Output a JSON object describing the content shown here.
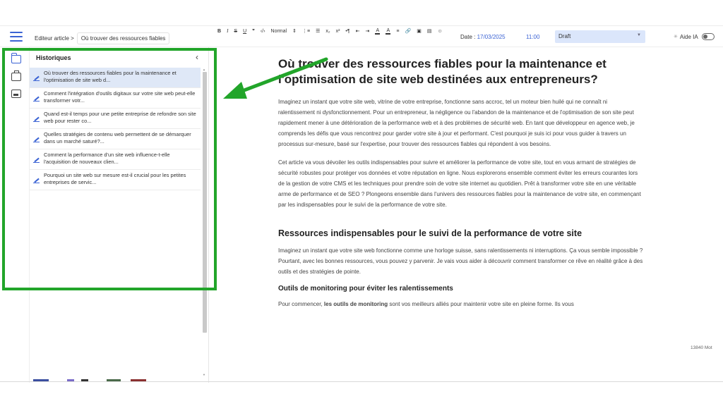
{
  "topbar": {
    "breadcrumb_root": "Editeur article >",
    "breadcrumb_current": "Où trouver des ressources fiables",
    "date_label": "Date :",
    "date_value": "17/03/2025",
    "time_value": "11:00",
    "status": "Draft",
    "ai_label": "Aide IA"
  },
  "history": {
    "title": "Historiques",
    "items": [
      {
        "text": "Où trouver des ressources fiables pour la maintenance et l'optimisation de site web d..."
      },
      {
        "text": "Comment l'intégration d'outils digitaux sur votre site web peut-elle transformer votr..."
      },
      {
        "text": "Quand est-il temps pour une petite entreprise de refondre son site web pour rester co..."
      },
      {
        "text": "Quelles stratégies de contenu web permettent de se démarquer dans un marché saturé?..."
      },
      {
        "text": "Comment la performance d'un site web influence-t-elle l'acquisition de nouveaux clien..."
      },
      {
        "text": "Pourquoi un site web sur mesure est-il crucial pour les petites entreprises de servic..."
      }
    ]
  },
  "toolbar": {
    "bold": "B",
    "italic": "I",
    "strike": "S",
    "underline": "U",
    "quote": "❞",
    "code": "‹/›",
    "format": "Normal",
    "format_caret": "⇕",
    "ol": "⋮≡",
    "ul": "☰",
    "sub": "x₂",
    "sup": "x²",
    "para": "•¶",
    "indent_out": "⇤",
    "indent_in": "⇥",
    "color": "A",
    "bgcolor": "A",
    "align": "≡",
    "link": "🔗",
    "image": "▣",
    "video": "▤",
    "emoji": "☺"
  },
  "article": {
    "h1": "Où trouver des ressources fiables pour la maintenance et l'optimisation de site web destinées aux entrepreneurs?",
    "p1": "Imaginez un instant que votre site web, vitrine de votre entreprise, fonctionne sans accroc, tel un moteur bien huilé qui ne connaît ni ralentissement ni dysfonctionnement. Pour un entrepreneur, la négligence ou l'abandon de la maintenance et de l'optimisation de son site peut rapidement mener à une détérioration de la performance web et à des problèmes de sécurité web. En tant que développeur en agence web, je comprends les défis que vous rencontrez pour garder votre site à jour et performant. C'est pourquoi je suis ici pour vous guider à travers un processus sur-mesure, basé sur l'expertise, pour trouver des ressources fiables qui répondent à vos besoins.",
    "p2": "Cet article va vous dévoiler les outils indispensables pour suivre et améliorer la performance de votre site, tout en vous armant de stratégies de sécurité robustes pour protéger vos données et votre réputation en ligne. Nous explorerons ensemble comment éviter les erreurs courantes lors de la gestion de votre CMS et les techniques pour prendre soin de votre site internet au quotidien. Prêt à transformer votre site en une véritable arme de performance et de SEO ? Plongeons ensemble dans l'univers des ressources fiables pour la maintenance de votre site, en commençant par les indispensables pour le suivi de la performance de votre site.",
    "h2": "Ressources indispensables pour le suivi de la performance de votre site",
    "p3": "Imaginez un instant que votre site web fonctionne comme une horloge suisse, sans ralentissements ni interruptions. Ça vous semble impossible ? Pourtant, avec les bonnes ressources, vous pouvez y parvenir. Je vais vous aider à découvrir comment transformer ce rêve en réalité grâce à des outils et des stratégies de pointe.",
    "h3": "Outils de monitoring pour éviter les ralentissements",
    "p4_before": "Pour commencer, ",
    "p4_bold": "les outils de monitoring",
    "p4_after": " sont vos meilleurs alliés pour maintenir votre site en pleine forme. Ils vous"
  },
  "word_count": "13840 Mot",
  "colors": {
    "accent": "#3b63d4",
    "highlight_box": "#22a52a",
    "active_item": "#dfe8f7",
    "status_bg": "#dbe6fb"
  }
}
